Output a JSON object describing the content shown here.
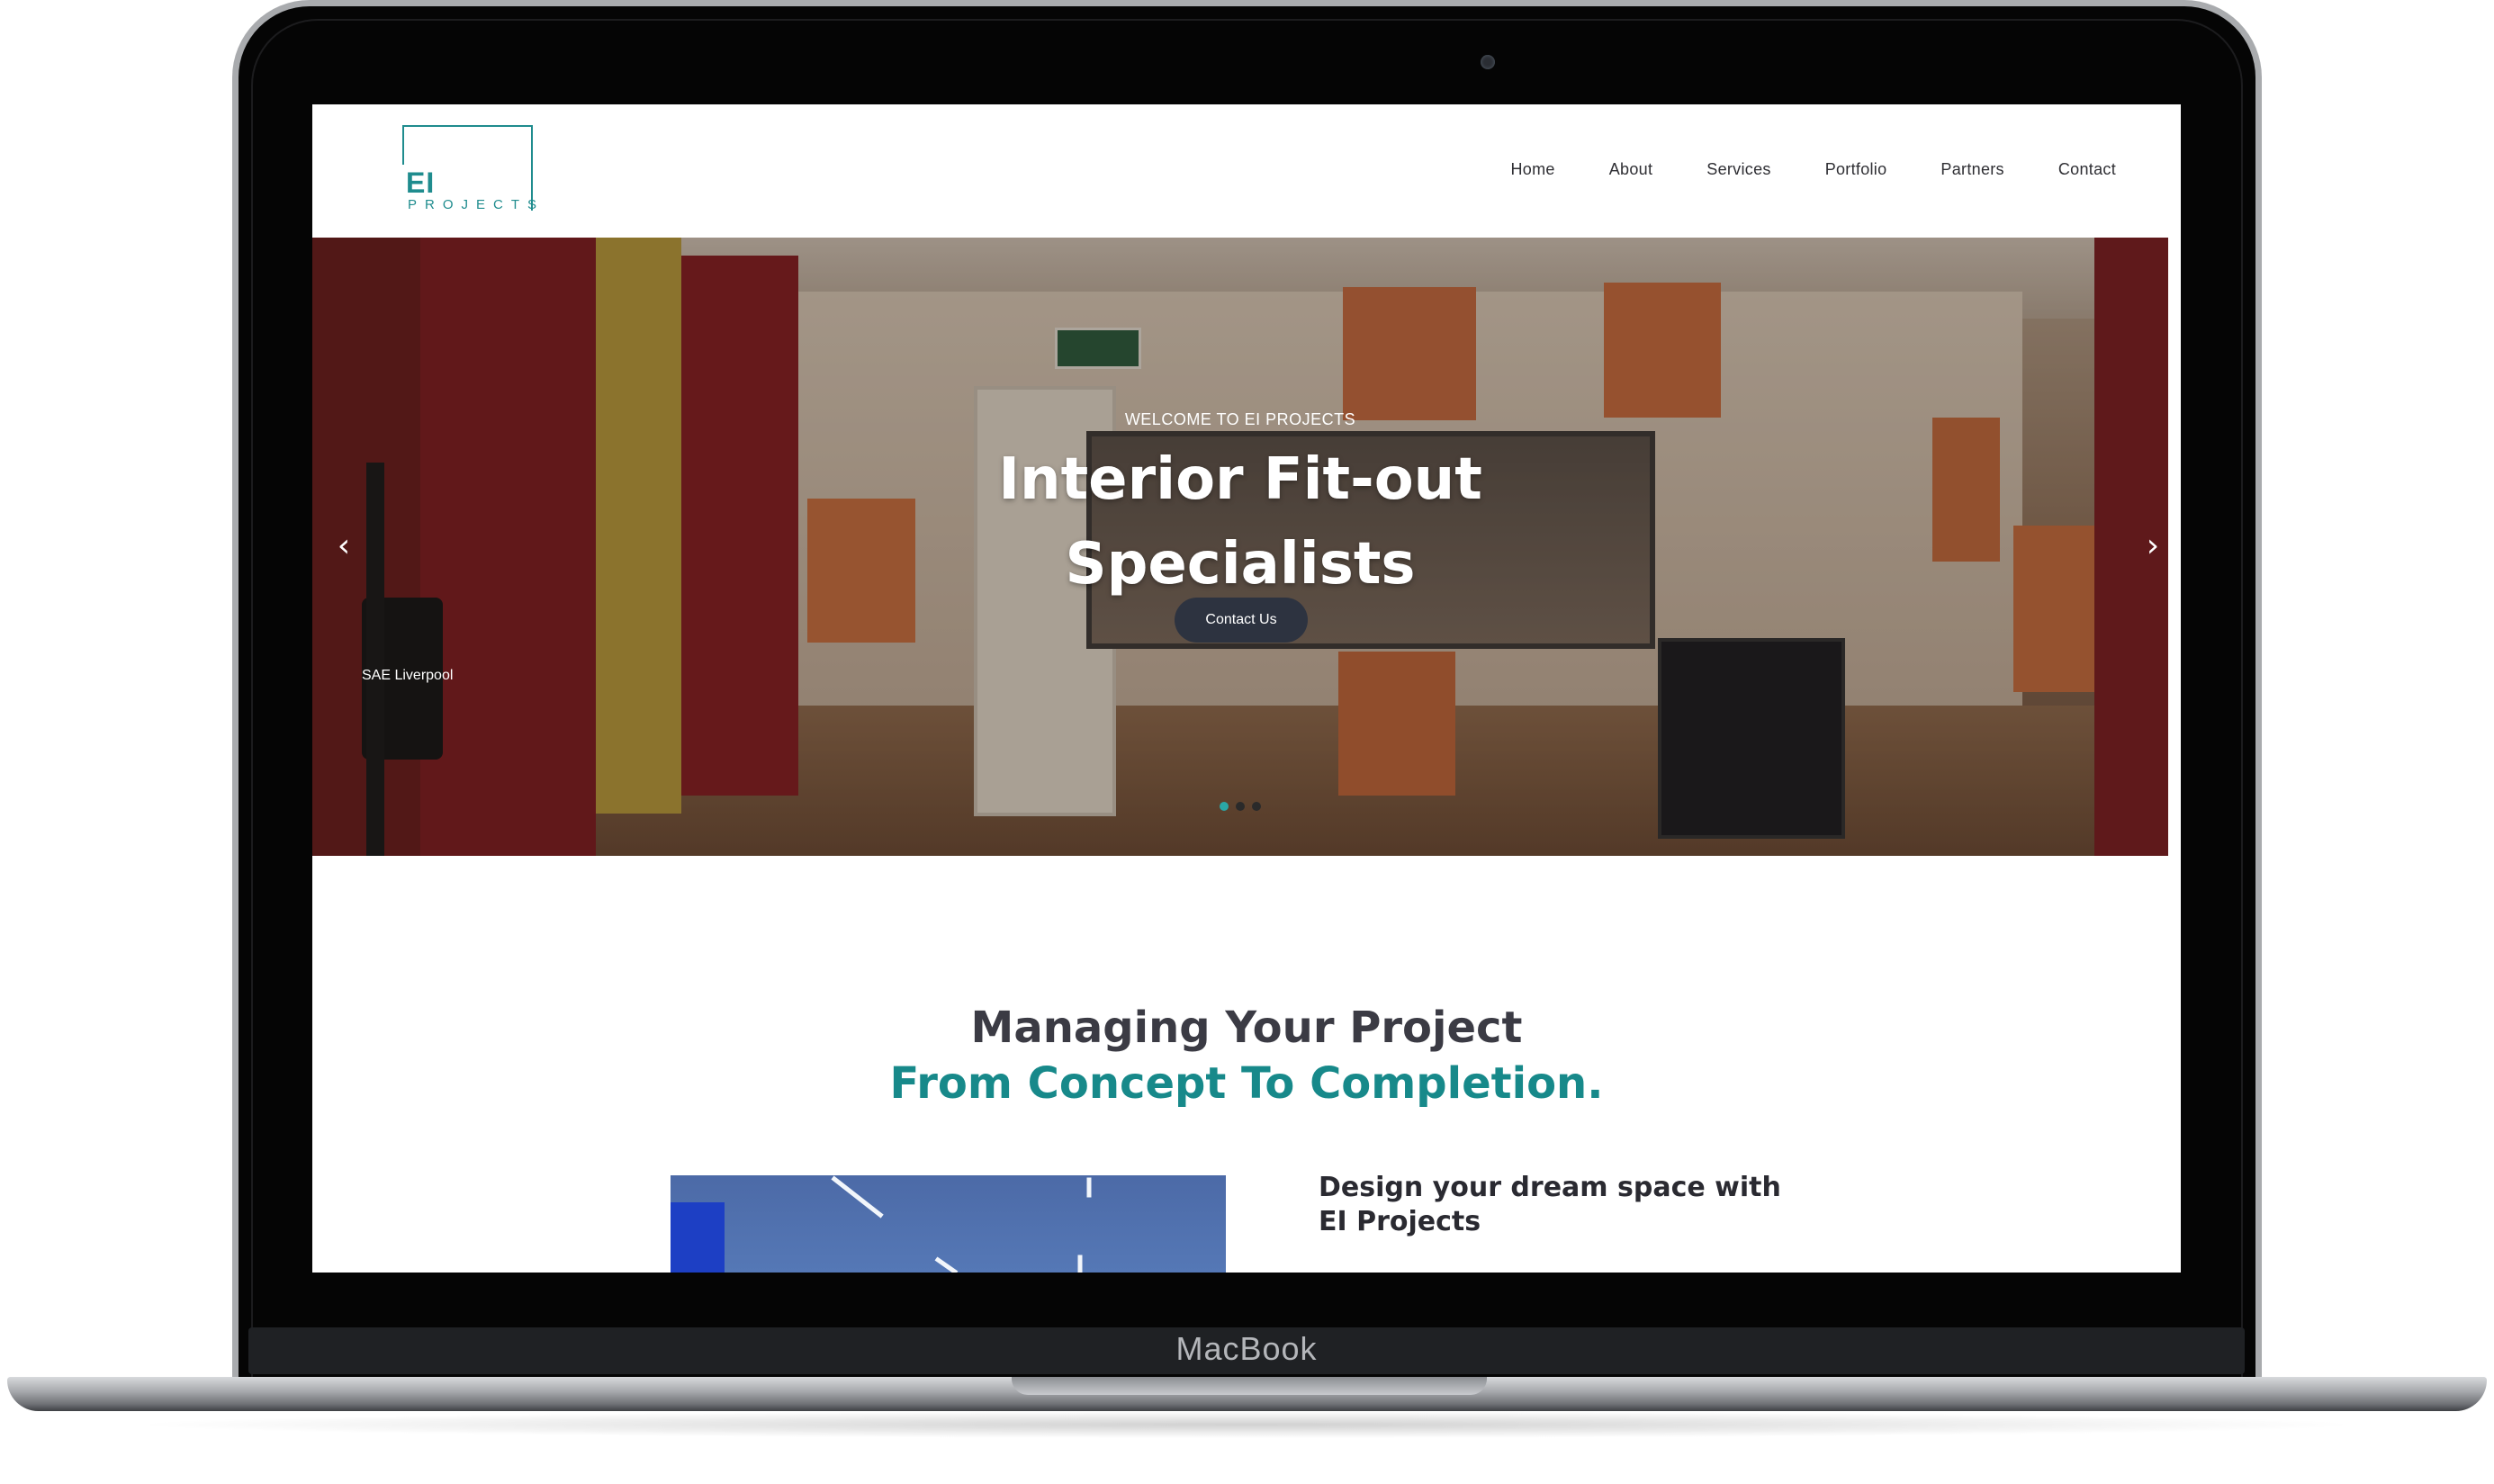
{
  "device": {
    "brand": "MacBook"
  },
  "header": {
    "logo": {
      "primary": "EI",
      "secondary": "PROJECTS"
    },
    "nav": [
      "Home",
      "About",
      "Services",
      "Portfolio",
      "Partners",
      "Contact"
    ]
  },
  "hero": {
    "kicker": "WELCOME TO EI PROJECTS",
    "title": "Interior Fit-out Specialists",
    "cta": "Contact Us",
    "caption": "SAE Liverpool",
    "slides": {
      "count": 3,
      "active_index": 0
    },
    "prev_icon": "chevron-left-icon",
    "next_icon": "chevron-right-icon"
  },
  "intro": {
    "heading_line_1": "Managing Your Project",
    "heading_line_2": "From Concept To Completion.",
    "design_heading": "Design your dream space with EI Projects"
  },
  "colors": {
    "accent": "#17898a",
    "heading": "#3b3b44",
    "cta_background": "#2d3340",
    "active_dot": "#2aa7a6"
  }
}
